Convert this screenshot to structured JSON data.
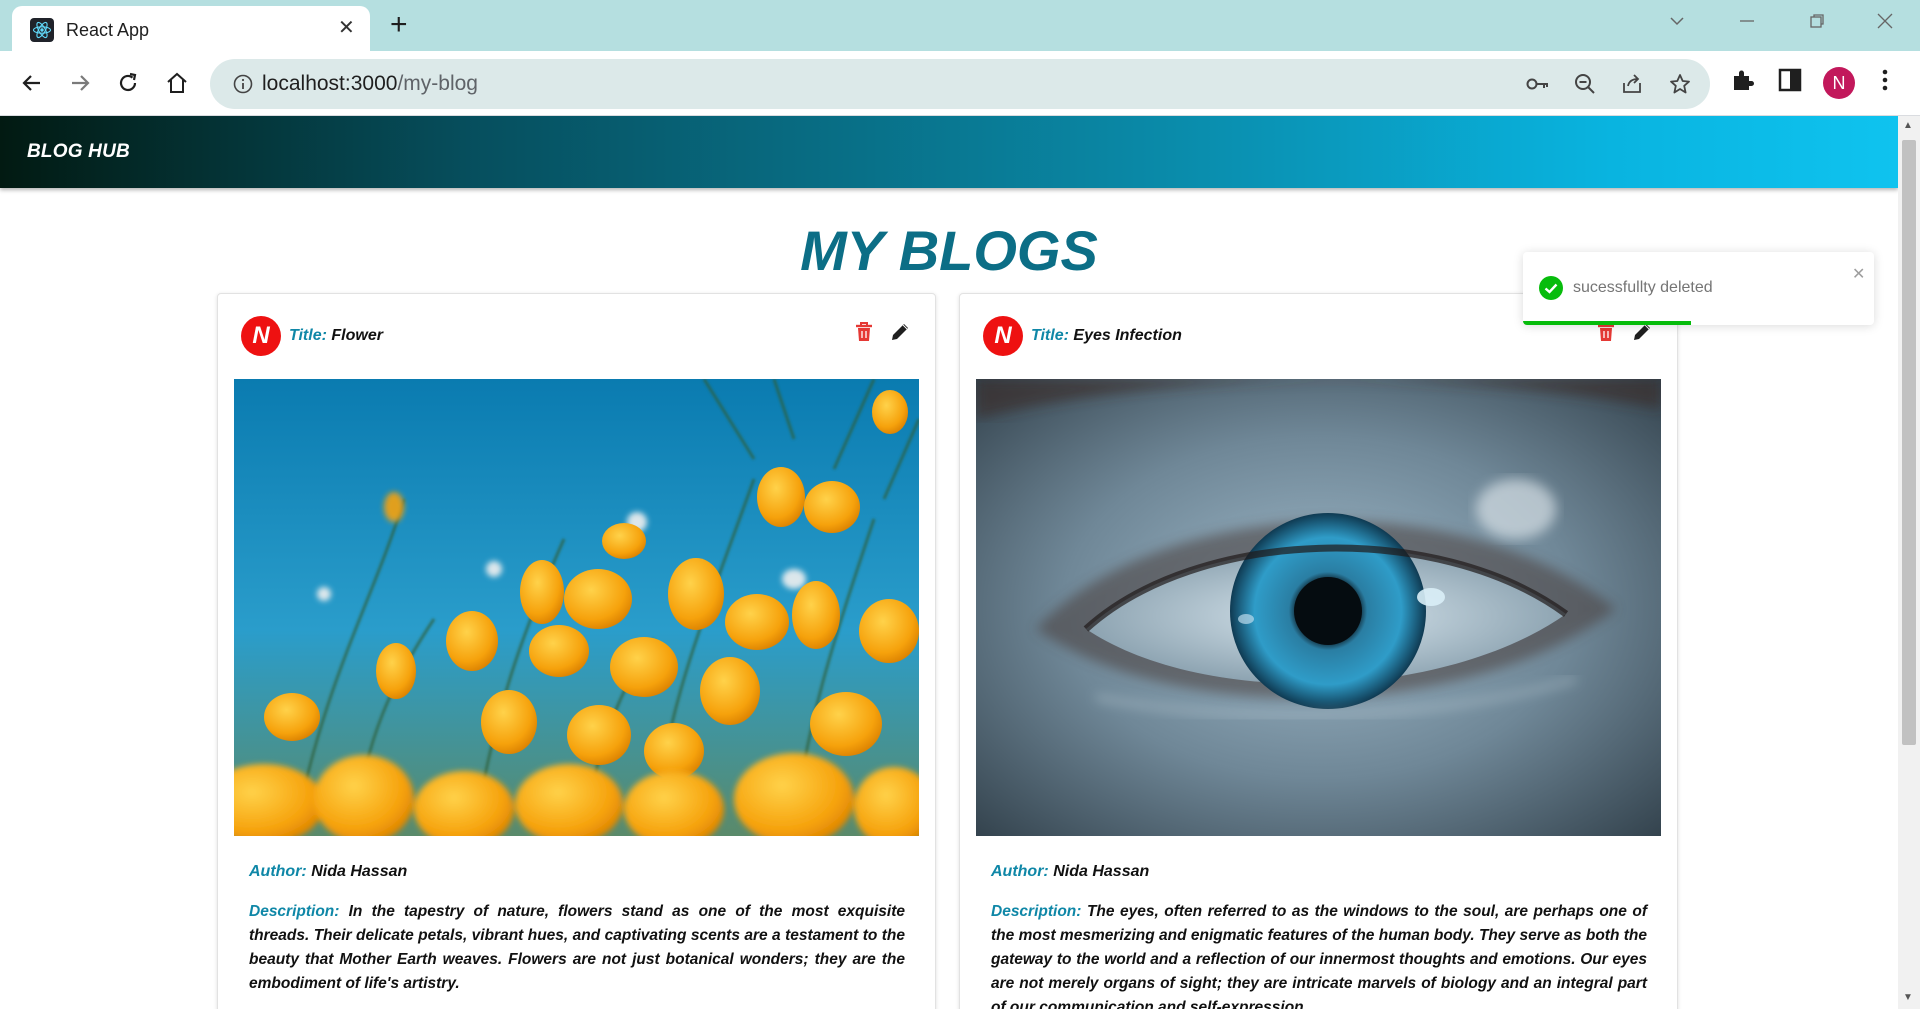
{
  "browser": {
    "tab_title": "React App",
    "url_host": "localhost:3000",
    "url_path": "/my-blog",
    "profile_initial": "N"
  },
  "app": {
    "brand": "BLOG HUB",
    "heading": "MY BLOGS"
  },
  "blogs": [
    {
      "avatar": "N",
      "title_label": "Title:",
      "title": "Flower",
      "author_label": "Author:",
      "author": "Nida Hassan",
      "description_label": "Description:",
      "description": "In the tapestry of nature, flowers stand as one of the most exquisite threads. Their delicate petals, vibrant hues, and captivating scents are a testament to the beauty that Mother Earth weaves. Flowers are not just botanical wonders; they are the embodiment of life's artistry.",
      "image": "flower-photo"
    },
    {
      "avatar": "N",
      "title_label": "Title:",
      "title": "Eyes Infection",
      "author_label": "Author:",
      "author": "Nida Hassan",
      "description_label": "Description:",
      "description": "The eyes, often referred to as the windows to the soul, are perhaps one of the most mesmerizing and enigmatic features of the human body. They serve as both the gateway to the world and a reflection of our innermost thoughts and emotions. Our eyes are not merely organs of sight; they are intricate marvels of biology and an integral part of our communication and self-expression.",
      "image": "eye-photo"
    }
  ],
  "toast": {
    "message": "sucessfullty deleted",
    "progress": 0.48,
    "type": "success"
  },
  "colors": {
    "accent": "#0c6e86",
    "label": "#0f87a7",
    "delete": "#e53935",
    "success": "#07bc0c"
  }
}
